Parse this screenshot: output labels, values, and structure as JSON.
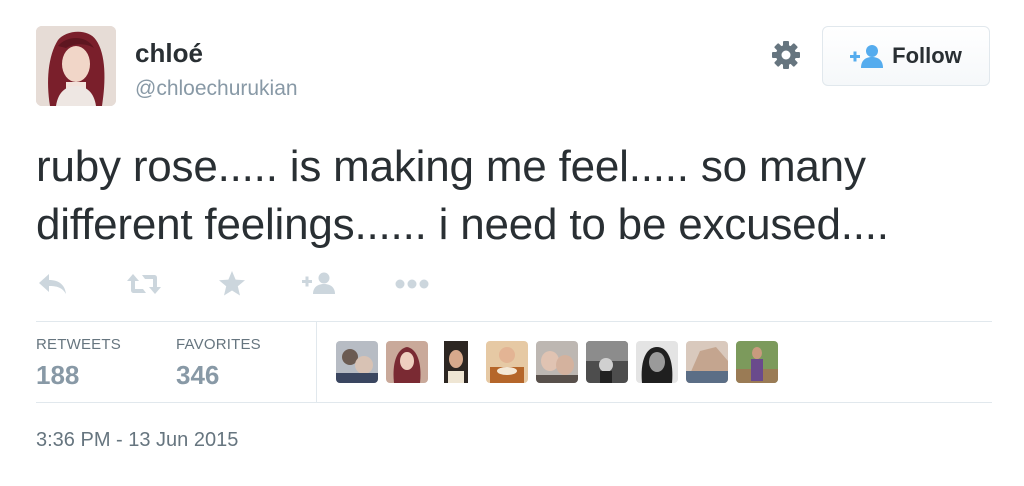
{
  "author": {
    "display_name": "chloé",
    "handle": "@chloechurukian"
  },
  "follow_button": {
    "label": "Follow"
  },
  "tweet": {
    "line1": "ruby rose..... is making me feel..... so many",
    "line2": "different feelings...... i need to be excused....",
    "timestamp": "3:36 PM - 13 Jun 2015"
  },
  "actions": [
    "reply-icon",
    "retweet-icon",
    "favorite-icon",
    "follow-icon",
    "more-icon"
  ],
  "stats": {
    "retweets_label": "RETWEETS",
    "retweets_value": "188",
    "favorites_label": "FAVORITES",
    "favorites_value": "346"
  },
  "colors": {
    "text": "#292f33",
    "muted": "#8899a6",
    "action_icon": "#ccd6dd",
    "follow_icon": "#55acee",
    "gear": "#66757f",
    "border": "#e1e8ed"
  }
}
